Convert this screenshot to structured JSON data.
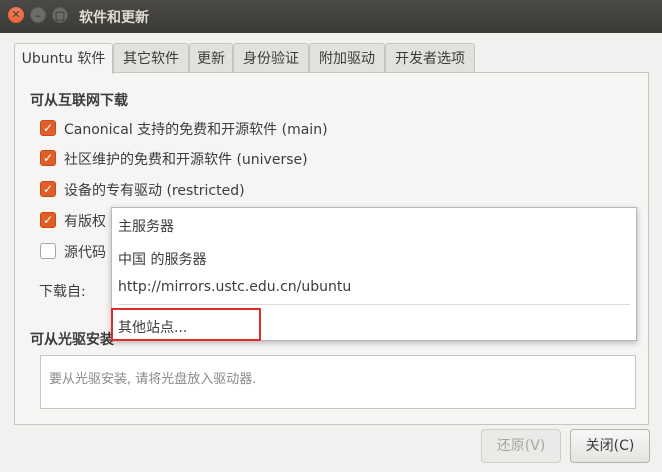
{
  "window": {
    "title": "软件和更新",
    "close_glyph": "✕",
    "min_glyph": "–",
    "max_glyph": "□"
  },
  "tabs": [
    {
      "label": "Ubuntu 软件",
      "active": true
    },
    {
      "label": "其它软件",
      "active": false
    },
    {
      "label": "更新",
      "active": false
    },
    {
      "label": "身份验证",
      "active": false
    },
    {
      "label": "附加驱动",
      "active": false
    },
    {
      "label": "开发者选项",
      "active": false
    }
  ],
  "internet": {
    "title": "可从互联网下载",
    "items": [
      {
        "label": "Canonical 支持的免费和开源软件 (main)",
        "checked": true
      },
      {
        "label": "社区维护的免费和开源软件 (universe)",
        "checked": true
      },
      {
        "label": "设备的专有驱动 (restricted)",
        "checked": true
      },
      {
        "label": "有版权",
        "checked": true
      },
      {
        "label": "源代码",
        "checked": false
      }
    ],
    "download_from_label": "下载自:"
  },
  "cdrom": {
    "title": "可从光驱安装",
    "placeholder": "要从光驱安装, 请将光盘放入驱动器."
  },
  "dropdown_menu": {
    "items": [
      "主服务器",
      "中国 的服务器",
      "http://mirrors.ustc.edu.cn/ubuntu"
    ],
    "other_sites": "其他站点..."
  },
  "buttons": {
    "revert": "还原(V)",
    "close": "关闭(C)"
  },
  "colors": {
    "accent_checkbox": "#e05e28",
    "titlebar": "#3c3b37",
    "highlight_box": "#e12a2a"
  }
}
